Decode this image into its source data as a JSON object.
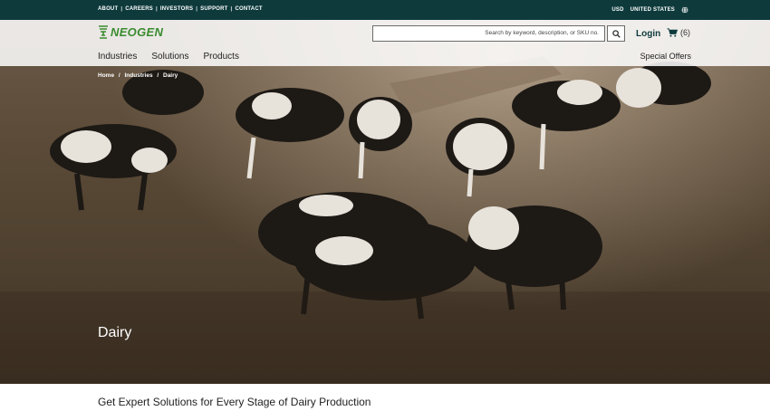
{
  "utility": {
    "links": [
      "ABOUT",
      "CAREERS",
      "INVESTORS",
      "SUPPORT",
      "CONTACT"
    ],
    "currency": "USD",
    "country": "UNITED STATES",
    "country_icon": "globe-icon"
  },
  "header": {
    "logo_text": "NEOGEN",
    "search_placeholder": "Search by keyword, description, or SKU no.",
    "search_icon": "search-icon",
    "login_label": "Login",
    "cart_icon": "cart-icon",
    "cart_count": "(6)",
    "nav": [
      "Industries",
      "Solutions",
      "Products"
    ],
    "special_offers": "Special Offers"
  },
  "breadcrumb": [
    "Home",
    "Industries",
    "Dairy"
  ],
  "hero": {
    "title": "Dairy"
  },
  "main": {
    "lead": "Get Expert Solutions for Every Stage of Dairy Production"
  },
  "colors": {
    "utility_bar": "#0e3a3c",
    "logo_green": "#3a8c2f"
  }
}
